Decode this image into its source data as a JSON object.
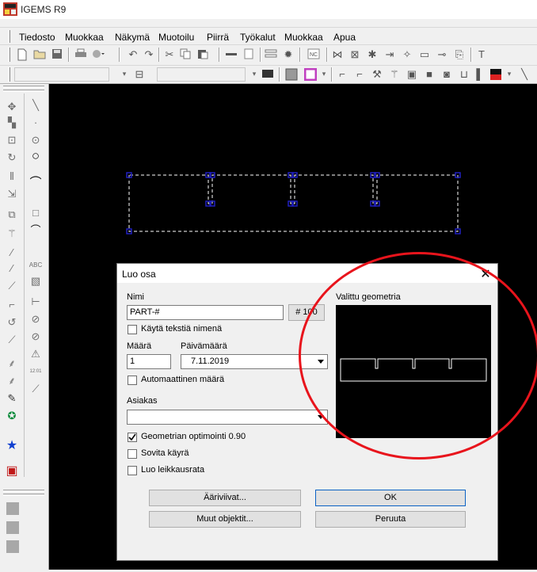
{
  "window": {
    "title": "IGEMS R9"
  },
  "menu": [
    "Tiedosto",
    "Muokkaa",
    "Näkymä",
    "Muotoilu",
    "Piirrä",
    "Työkalut",
    "Muokkaa",
    "Apua"
  ],
  "toolbar2": {
    "scale_symbol": "T",
    "dropdown_arrow": "▾"
  },
  "dialog": {
    "title": "Luo osa",
    "close_glyph": "✕",
    "name_label": "Nimi",
    "name_value": "PART-#",
    "number_button": "# 100",
    "use_text_name_label": "Käytä tekstiä nimenä",
    "use_text_name_checked": false,
    "quantity_label": "Määrä",
    "quantity_value": "1",
    "date_label": "Päivämäärä",
    "date_value": "7.11.2019",
    "auto_quantity_label": "Automaattinen määrä",
    "auto_quantity_checked": false,
    "customer_label": "Asiakas",
    "customer_value": "",
    "geometry_optimize_label": "Geometrian optimointi 0.90",
    "geometry_optimize_checked": true,
    "fit_curve_label": "Sovita käyrä",
    "fit_curve_checked": false,
    "create_cut_path_label": "Luo leikkausrata",
    "create_cut_path_checked": false,
    "outlines_button": "Ääriviivat...",
    "other_objects_button": "Muut objektit...",
    "ok_button": "OK",
    "cancel_button": "Peruuta",
    "preview_label": "Valittu geometria"
  },
  "colors": {
    "selection_handle": "#2020c0",
    "annotation_circle": "#e8141c",
    "canvas_bg": "#000000"
  },
  "icons": [
    "new-file-icon",
    "open-folder-icon",
    "save-icon",
    "print-icon",
    "undo-icon",
    "redo-icon",
    "cut-icon",
    "copy-icon",
    "paste-icon",
    "settings-gear-icon",
    "nc-icon",
    "move-icon",
    "line-icon",
    "circle-icon",
    "arc-icon",
    "rectangle-icon",
    "polyline-icon",
    "text-abc-icon",
    "star-icon",
    "gift-icon"
  ]
}
